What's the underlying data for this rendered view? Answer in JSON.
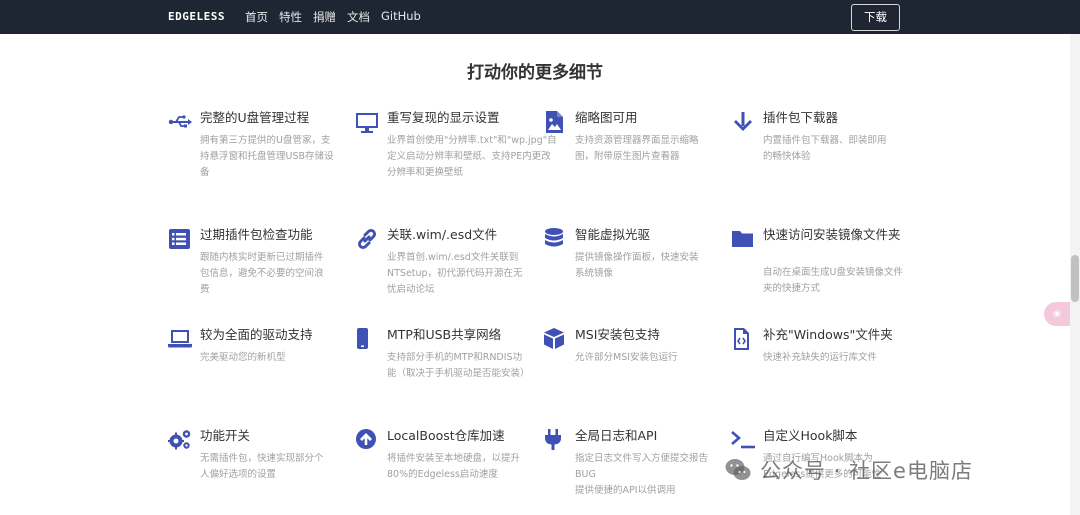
{
  "nav": {
    "brand": "EDGELESS",
    "links": [
      "首页",
      "特性",
      "捐赠",
      "文档",
      "GitHub"
    ],
    "download": "下载"
  },
  "section": {
    "title": "打动你的更多细节"
  },
  "features": [
    {
      "icon": "usb-icon",
      "title": "完整的U盘管理过程",
      "desc": "拥有第三方提供的U盘管家，支持悬浮窗和托盘管理USB存储设备"
    },
    {
      "icon": "monitor-icon",
      "title": "重写复现的显示设置",
      "desc": "业界首创使用\"分辨率.txt\"和\"wp.jpg\"自定义启动分辨率和壁纸、支持PE内更改分辨率和更换壁纸"
    },
    {
      "icon": "image-file-icon",
      "title": "缩略图可用",
      "desc": "支持资源管理器界面显示缩略图，附带原生图片查看器"
    },
    {
      "icon": "download-arrow-icon",
      "title": "插件包下载器",
      "desc": "内置插件包下载器、即装即用的畅快体验"
    },
    {
      "icon": "list-icon",
      "title": "过期插件包检查功能",
      "desc": "跟随内核实时更新已过期插件包信息，避免不必要的空间浪费"
    },
    {
      "icon": "link-icon",
      "title": "关联.wim/.esd文件",
      "desc": "业界首创.wim/.esd文件关联到NTSetup，初代源代码开源在无忧启动论坛"
    },
    {
      "icon": "database-icon",
      "title": "智能虚拟光驱",
      "desc": "提供镜像操作面板，快速安装系统镜像"
    },
    {
      "icon": "folder-icon",
      "title": "快速访问安装镜像文件夹",
      "desc": "自动在桌面生成U盘安装镜像文件夹的快捷方式"
    },
    {
      "icon": "laptop-icon",
      "title": "较为全面的驱动支持",
      "desc": "完美驱动您的新机型"
    },
    {
      "icon": "mobile-icon",
      "title": "MTP和USB共享网络",
      "desc": "支持部分手机的MTP和RNDIS功能（取决于手机驱动是否能安装）"
    },
    {
      "icon": "cube-icon",
      "title": "MSI安装包支持",
      "desc": "允许部分MSI安装包运行"
    },
    {
      "icon": "code-file-icon",
      "title": "补充\"Windows\"文件夹",
      "desc": "快速补充缺失的运行库文件"
    },
    {
      "icon": "gears-icon",
      "title": "功能开关",
      "desc": "无需插件包，快速实现部分个人偏好选项的设置"
    },
    {
      "icon": "upload-circle-icon",
      "title": "LocalBoost仓库加速",
      "desc": "将插件安装至本地硬盘，以提升80%的Edgeless启动速度"
    },
    {
      "icon": "plug-icon",
      "title": "全局日志和API",
      "desc": "指定日志文件写入方便提交报告BUG\n提供便捷的API以供调用"
    },
    {
      "icon": "terminal-icon",
      "title": "自定义Hook脚本",
      "desc": "通过自行编写Hook脚本为Edgeless提供更多的可能性"
    }
  ],
  "watermark": {
    "text": "公众号 · 社区e电脑店"
  },
  "colors": {
    "nav_bg": "#1f2633",
    "icon": "#3f51b5",
    "muted": "#a0a0a0"
  }
}
